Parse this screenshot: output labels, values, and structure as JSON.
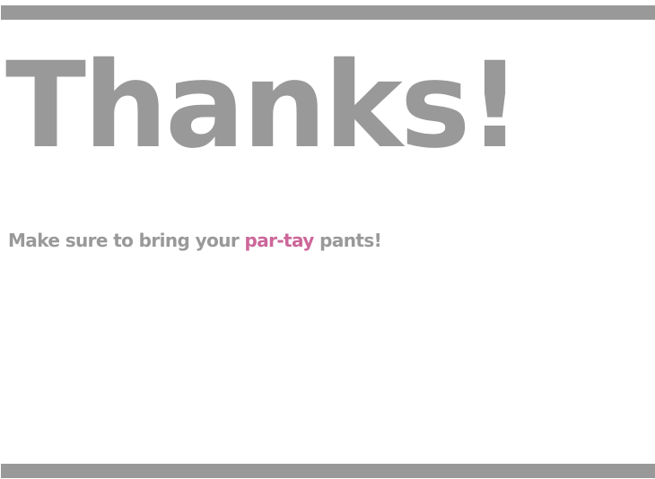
{
  "heading": "Thanks!",
  "message": {
    "before": "Make sure to bring your ",
    "highlight": "par-tay",
    "after": " pants!"
  },
  "colors": {
    "text": "#999999",
    "bars": "#999999",
    "highlight": "#cc6699",
    "background": "#ffffff"
  }
}
